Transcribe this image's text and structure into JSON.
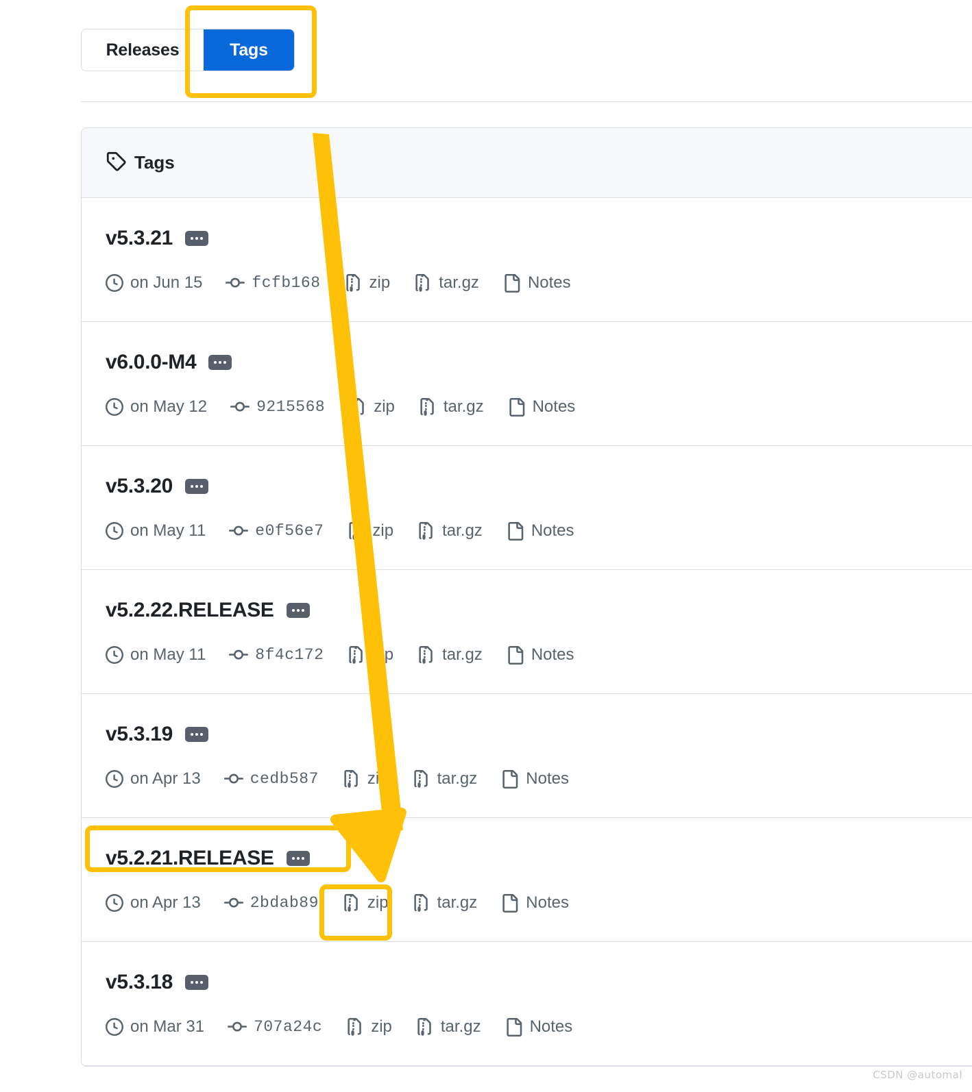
{
  "toggle": {
    "releases_label": "Releases",
    "tags_label": "Tags",
    "active": "Tags",
    "active_color": "#0969da"
  },
  "panel": {
    "header_label": "Tags",
    "header_icon": "tag-icon"
  },
  "labels": {
    "zip": "zip",
    "targz": "tar.gz",
    "notes": "Notes",
    "clock_icon": "clock-icon",
    "commit_icon": "git-commit-icon",
    "file_zip_icon": "file-zip-icon",
    "file_icon": "file-icon",
    "verified_badge": "verified-badge-dots"
  },
  "tags": [
    {
      "name": "v5.3.21",
      "date": "on Jun 15",
      "commit": "fcfb168",
      "zip": "zip",
      "targz": "tar.gz",
      "notes": "Notes"
    },
    {
      "name": "v6.0.0-M4",
      "date": "on May 12",
      "commit": "9215568",
      "zip": "zip",
      "targz": "tar.gz",
      "notes": "Notes"
    },
    {
      "name": "v5.3.20",
      "date": "on May 11",
      "commit": "e0f56e7",
      "zip": "zip",
      "targz": "tar.gz",
      "notes": "Notes"
    },
    {
      "name": "v5.2.22.RELEASE",
      "date": "on May 11",
      "commit": "8f4c172",
      "zip": "zip",
      "targz": "tar.gz",
      "notes": "Notes"
    },
    {
      "name": "v5.3.19",
      "date": "on Apr 13",
      "commit": "cedb587",
      "zip": "zip",
      "targz": "tar.gz",
      "notes": "Notes"
    },
    {
      "name": "v5.2.21.RELEASE",
      "date": "on Apr 13",
      "commit": "2bdab89",
      "zip": "zip",
      "targz": "tar.gz",
      "notes": "Notes"
    },
    {
      "name": "v5.3.18",
      "date": "on Mar 31",
      "commit": "707a24c",
      "zip": "zip",
      "targz": "tar.gz",
      "notes": "Notes"
    }
  ],
  "annotations": {
    "highlight_color": "#FFC107",
    "boxes": [
      "tags-toggle",
      "v5.2.21.RELEASE-name",
      "zip-link"
    ],
    "arrow": "points from Tags toggle down to the v5.2.21.RELEASE zip link"
  },
  "watermark": {
    "text": "CSDN @automal"
  }
}
